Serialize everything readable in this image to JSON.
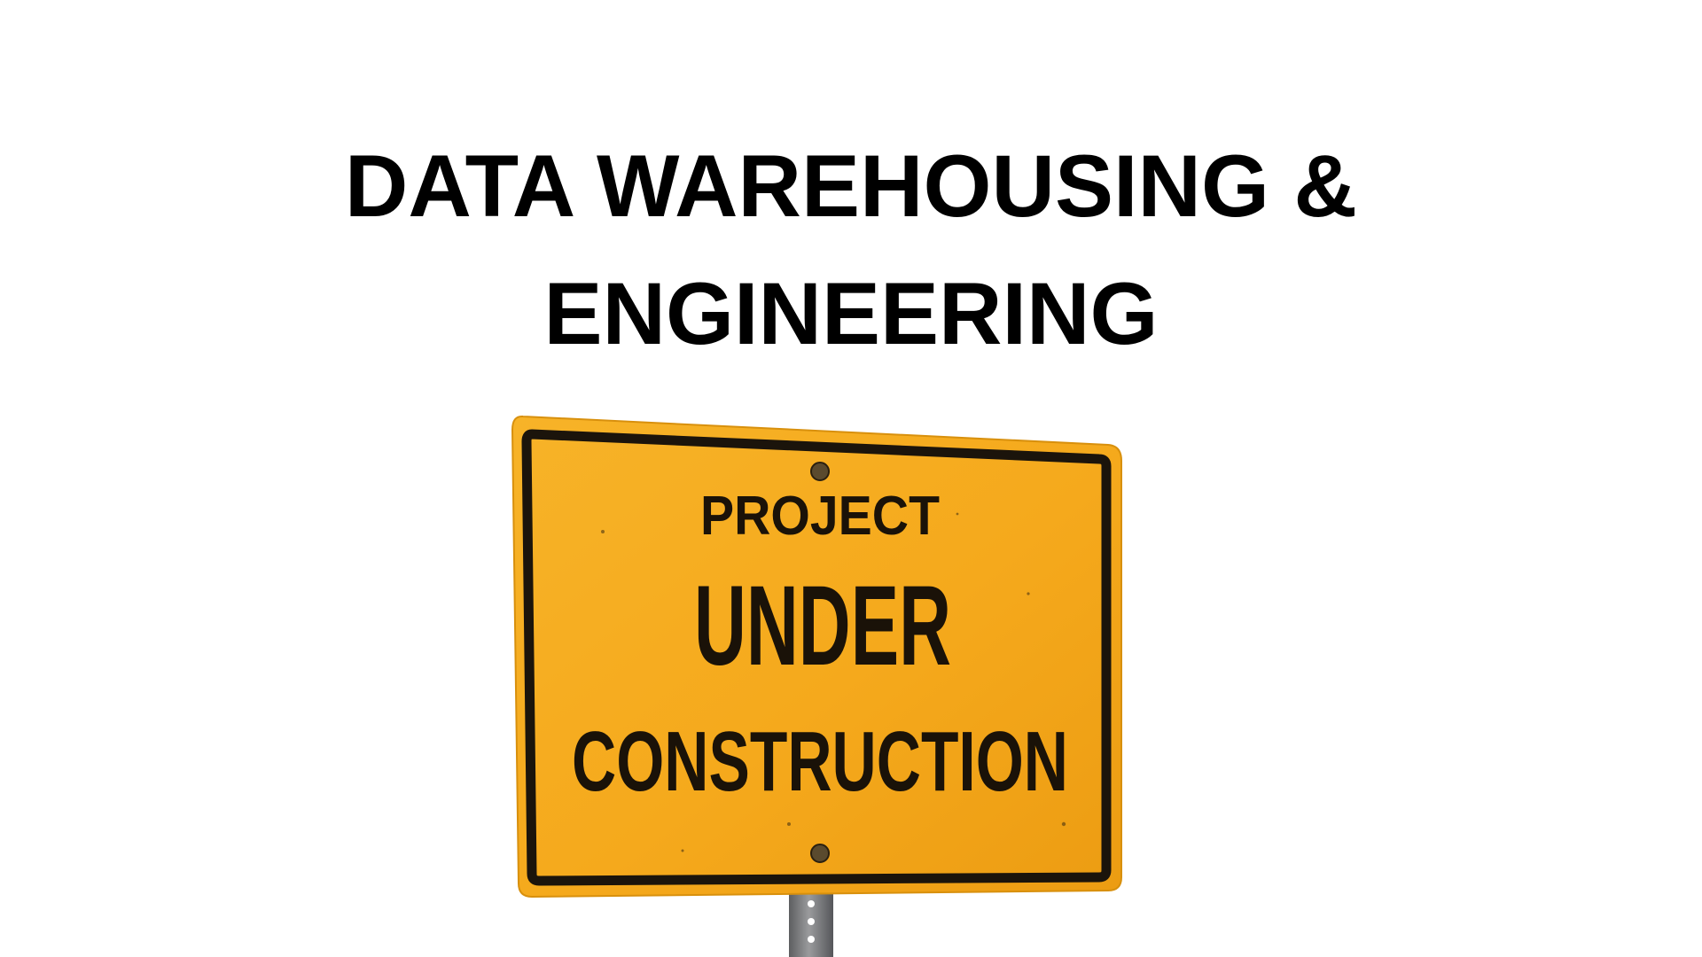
{
  "slide": {
    "title_line1": "DATA WAREHOUSING &",
    "title_line2": "ENGINEERING"
  },
  "sign": {
    "line1": "PROJECT",
    "line2": "UNDER",
    "line3": "CONSTRUCTION",
    "colors": {
      "face": "#f5a91c",
      "border": "#1b140b",
      "post": "#7d7e80"
    }
  }
}
